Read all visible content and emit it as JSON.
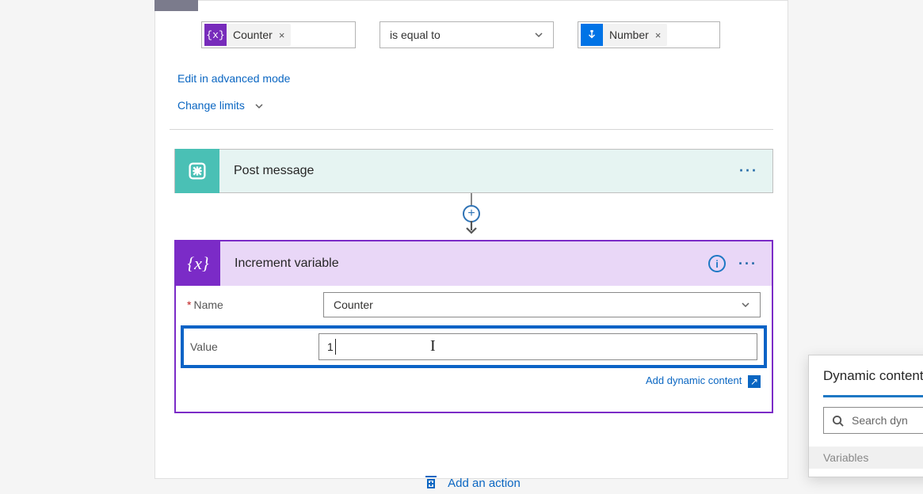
{
  "condition": {
    "left_token": {
      "label": "Counter",
      "icon": "variable"
    },
    "operator": "is equal to",
    "right_token": {
      "label": "Number",
      "icon": "number"
    }
  },
  "links": {
    "edit_advanced": "Edit in advanced mode",
    "change_limits": "Change limits"
  },
  "post_card": {
    "title": "Post message"
  },
  "increment_card": {
    "title": "Increment variable",
    "name_label": "Name",
    "name_value": "Counter",
    "value_label": "Value",
    "value_value": "1",
    "add_dynamic": "Add dynamic content"
  },
  "add_action": "Add an action",
  "dynamic_panel": {
    "title": "Dynamic content",
    "search_placeholder": "Search dyn",
    "category": "Variables"
  }
}
